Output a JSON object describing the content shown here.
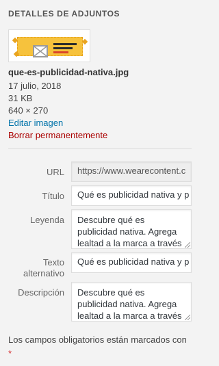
{
  "section": {
    "title": "DETALLES DE ADJUNTOS"
  },
  "attachment": {
    "filename": "que-es-publicidad-nativa.jpg",
    "date": "17 julio, 2018",
    "filesize": "31 KB",
    "dimensions": "640 × 270",
    "edit_label": "Editar imagen",
    "delete_label": "Borrar permanentemente"
  },
  "fields": {
    "url": {
      "label": "URL",
      "value": "https://www.wearecontent.c"
    },
    "title": {
      "label": "Título",
      "value": "Qué es publicidad nativa y p"
    },
    "caption": {
      "label": "Leyenda",
      "value": "Descubre qué es publicidad nativa. Agrega lealtad a la marca a través de contenido interesante y"
    },
    "alt": {
      "label_line1": "Texto",
      "label_line2": "alternativo",
      "value": "Qué es publicidad nativa y p"
    },
    "description": {
      "label": "Descripción",
      "value": "Descubre qué es publicidad nativa. Agrega lealtad a la marca a través de contenido interesante y"
    }
  },
  "required_note": {
    "text": "Los campos obligatorios están marcados con",
    "star": "*"
  },
  "colors": {
    "link": "#0073aa",
    "delete": "#aa0000",
    "required": "#d63638"
  }
}
